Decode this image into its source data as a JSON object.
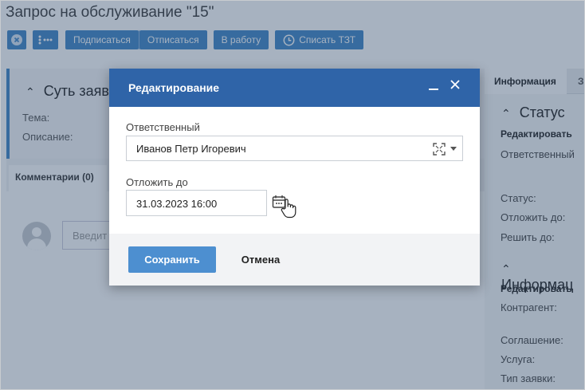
{
  "page": {
    "title": "Запрос на обслуживание \"15\""
  },
  "toolbar": {
    "close_icon": "close-circle-icon",
    "more_icon": "more-icon",
    "subscribe_label": "Подписаться",
    "unsubscribe_label": "Отписаться",
    "in_work_label": "В работу",
    "write_off_label": "Списать ТЗТ",
    "accent": "#3f86c6"
  },
  "left_panel": {
    "card_title": "Суть заявк",
    "topic_label": "Тема:",
    "description_label": "Описание:",
    "comments_tab": "Комментарии (0)",
    "comment_placeholder": "Введит"
  },
  "right_panel": {
    "tab_info": "Информация",
    "tab_next": "З",
    "status_section": "Статус",
    "edit_label_1": "Редактировать",
    "responsible_label": "Ответственный",
    "status_label": "Статус:",
    "postpone_label": "Отложить до:",
    "resolve_label": "Решить до:",
    "info_section": "Информац",
    "edit_label_2": "Редактировать",
    "counterparty_label": "Контрагент:",
    "agreement_label": "Соглашение:",
    "service_label": "Услуга:",
    "request_type_label": "Тип заявки:"
  },
  "dialog": {
    "title": "Редактирование",
    "minimize_icon": "minimize-icon",
    "close_icon": "close-icon",
    "responsible_label": "Ответственный",
    "responsible_value": "Иванов Петр Игоревич",
    "postpone_label": "Отложить до",
    "postpone_value": "31.03.2023 16:00",
    "save_label": "Сохранить",
    "cancel_label": "Отмена",
    "header_color": "#2f64a8"
  }
}
